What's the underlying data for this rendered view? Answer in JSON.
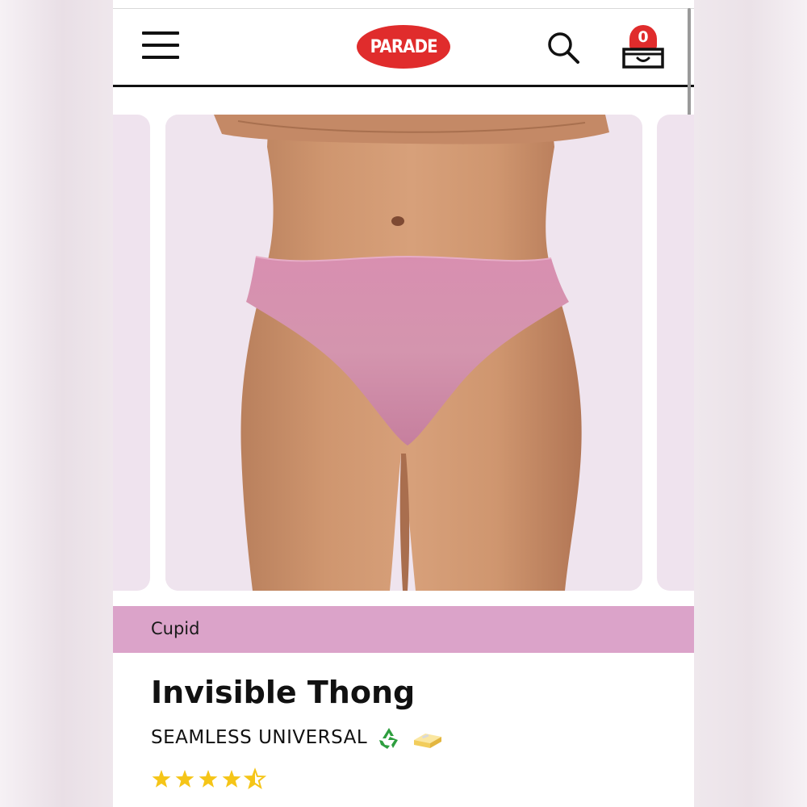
{
  "header": {
    "logo_text": "PARADE",
    "cart_count": "0",
    "icons": {
      "menu": "hamburger-menu-icon",
      "search": "search-icon",
      "cart": "cart-drawer-icon"
    }
  },
  "gallery": {
    "current_image": "product-photo-pink-thong"
  },
  "product": {
    "color_name": "Cupid",
    "title": "Invisible Thong",
    "subtitle": "SEAMLESS UNIVERSAL",
    "badges": [
      "recycle-icon",
      "butter-icon"
    ],
    "rating": 4.5,
    "rating_max": 5
  },
  "colors": {
    "brand_red": "#e02c2c",
    "color_bar": "#dba3c9",
    "card_bg": "#efe4ee",
    "star": "#f5c518",
    "product_pink": "#d792ae"
  }
}
